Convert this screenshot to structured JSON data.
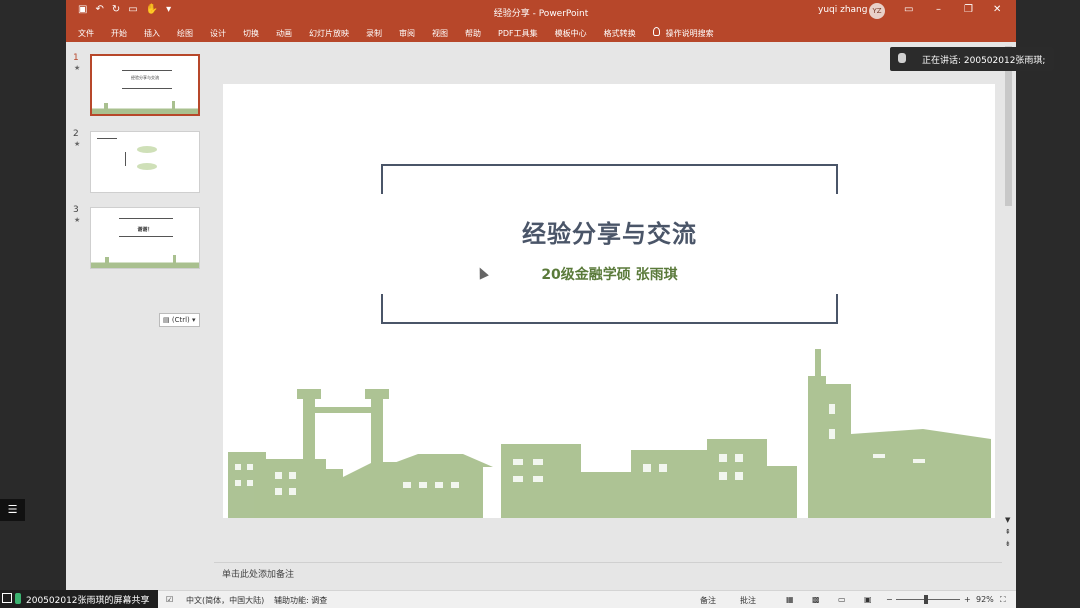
{
  "app": {
    "title": "经验分享 - PowerPoint",
    "user_name": "yuqi zhang",
    "user_initials": "YZ"
  },
  "ribbon": {
    "tabs": [
      "文件",
      "开始",
      "插入",
      "绘图",
      "设计",
      "切换",
      "动画",
      "幻灯片放映",
      "录制",
      "审阅",
      "视图",
      "帮助",
      "PDF工具集",
      "模板中心",
      "格式转换"
    ],
    "search_label": "操作说明搜索"
  },
  "thumbnails": [
    {
      "number": "1",
      "title": "经验分享与交流",
      "selected": true
    },
    {
      "number": "2",
      "title": "",
      "selected": false
    },
    {
      "number": "3",
      "title": "谢谢！",
      "selected": false
    }
  ],
  "paste_options": "(Ctrl)",
  "slide": {
    "title": "经验分享与交流",
    "subtitle": "20级金融学硕   张雨琪"
  },
  "notes": {
    "placeholder": "单击此处添加备注"
  },
  "status": {
    "language": "中文(简体，中国大陆)",
    "accessibility": "辅助功能: 调查",
    "notes_button": "备注",
    "comments_button": "批注",
    "zoom": "92%"
  },
  "meeting": {
    "speaking": "正在讲话: 2005020​12张雨琪;",
    "share_label": "2005020​12张雨琪的屏幕共享"
  },
  "colors": {
    "accent": "#b7472a",
    "title_color": "#4a5568",
    "subtitle_color": "#5a7a3a",
    "skyline": "#a9c08f"
  }
}
